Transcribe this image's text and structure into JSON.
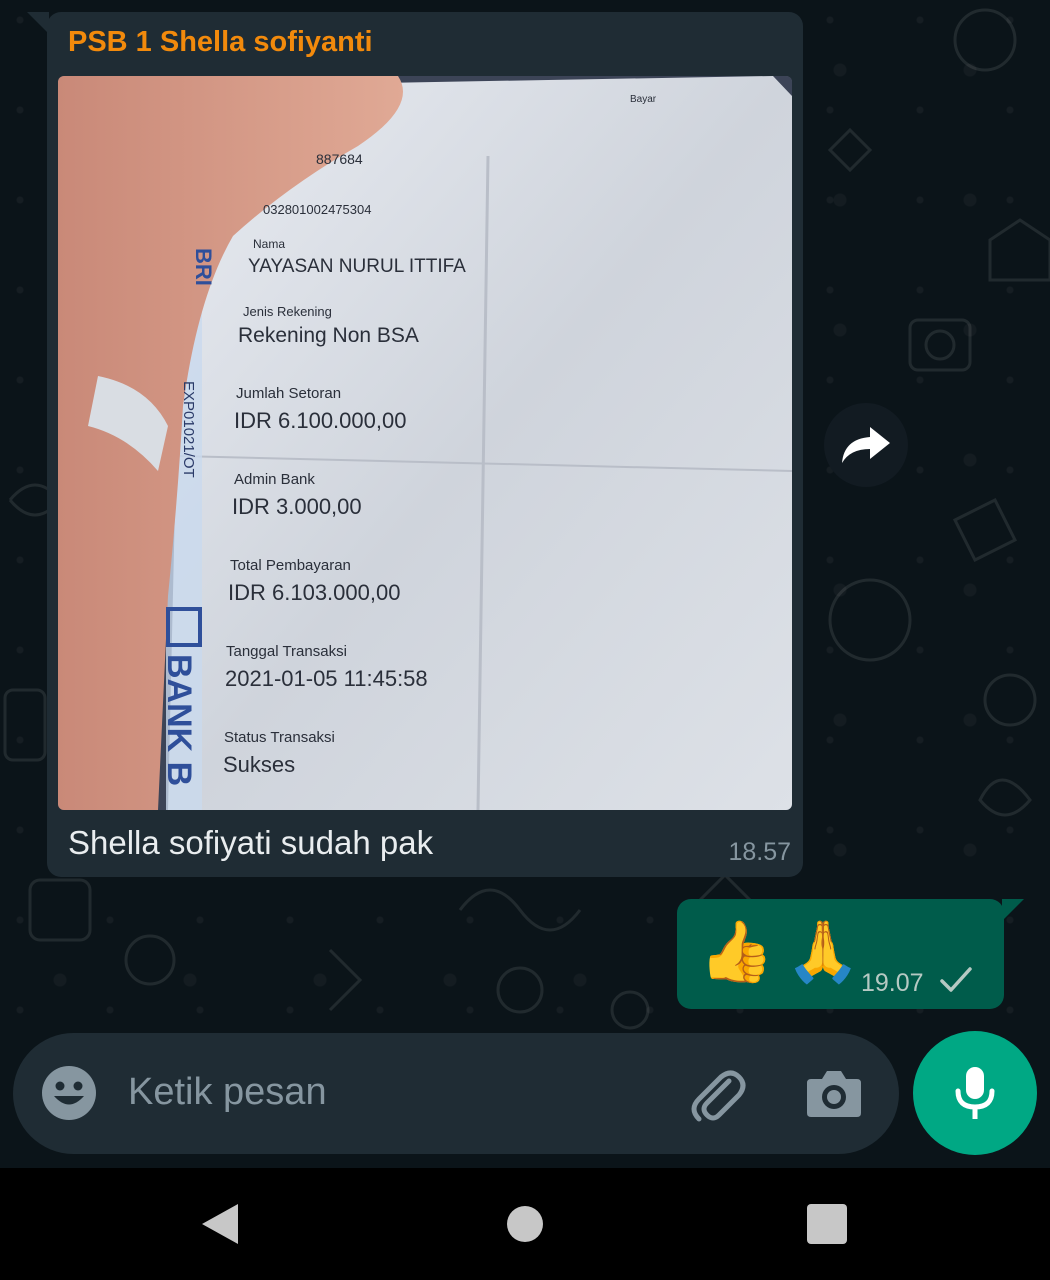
{
  "chat": {
    "incoming": {
      "sender": "PSB 1 Shella sofiyanti",
      "caption": "Shella sofiyati sudah pak",
      "time": "18.57",
      "photo": {
        "account_number_partial": "887684",
        "account_number": "032801002475304",
        "name_label": "Nama",
        "name_value": "YAYASAN NURUL ITTIFA",
        "type_label": "Jenis Rekening",
        "type_value": "Rekening Non BSA",
        "amount_label": "Jumlah Setoran",
        "amount_value": "IDR 6.100.000,00",
        "fee_label": "Admin Bank",
        "fee_value": "IDR 3.000,00",
        "total_label": "Total Pembayaran",
        "total_value": "IDR 6.103.000,00",
        "date_label": "Tanggal Transaksi",
        "date_value": "2021-01-05 11:45:58",
        "status_label": "Status Transaksi",
        "status_value": "Sukses",
        "side_code": "EXP01021/OT",
        "bank_brand": "BANK B",
        "bri_text": "BRI",
        "top_label": "Bayar"
      }
    },
    "outgoing": {
      "text": "👍 🙏",
      "emoji1": "👍",
      "emoji2": "🙏",
      "time": "19.07"
    }
  },
  "input": {
    "placeholder": "Ketik pesan"
  },
  "colors": {
    "sender": "#f28a0c",
    "incoming_bubble": "#1f2c34",
    "outgoing_bubble": "#005c4b",
    "mic_button": "#00a884"
  }
}
